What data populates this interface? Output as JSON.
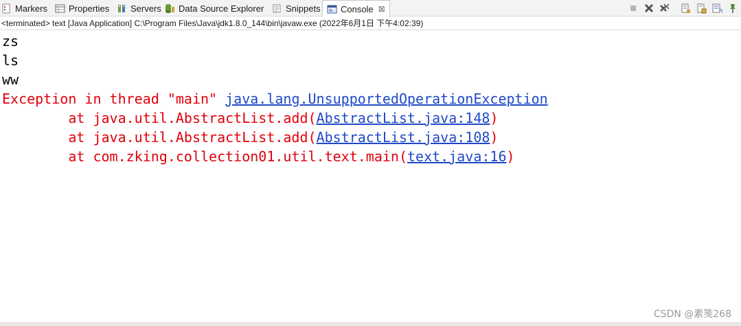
{
  "tabs": [
    {
      "label": "Markers",
      "icon": "markers-icon",
      "active": false
    },
    {
      "label": "Properties",
      "icon": "properties-icon",
      "active": false
    },
    {
      "label": "Servers",
      "icon": "servers-icon",
      "active": false
    },
    {
      "label": "Data Source Explorer",
      "icon": "data-source-icon",
      "active": false
    },
    {
      "label": "Snippets",
      "icon": "snippets-icon",
      "active": false
    },
    {
      "label": "Console",
      "icon": "console-icon",
      "active": true,
      "close": "⊠"
    }
  ],
  "toolbar_icons": [
    "terminate-icon",
    "remove-launch-icon",
    "remove-all-launches-icon",
    "clear-console-icon",
    "scroll-lock-icon",
    "word-wrap-icon",
    "pin-console-icon"
  ],
  "status": "<terminated> text [Java Application] C:\\Program Files\\Java\\jdk1.8.0_144\\bin\\javaw.exe (2022年6月1日 下午4:02:39)",
  "console": {
    "out_lines": [
      "zs",
      "ls",
      "ww"
    ],
    "exception_prefix": "Exception in thread \"main\" ",
    "exception_class": "java.lang.UnsupportedOperationException",
    "stack": [
      {
        "prefix": "        at java.util.AbstractList.add(",
        "link": "AbstractList.java:148",
        "suffix": ")"
      },
      {
        "prefix": "        at java.util.AbstractList.add(",
        "link": "AbstractList.java:108",
        "suffix": ")"
      },
      {
        "prefix": "        at com.zking.collection01.util.text.main(",
        "link": "text.java:16",
        "suffix": ")"
      }
    ]
  },
  "colors": {
    "stdout": "#000000",
    "stderr": "#e0000c",
    "link": "#1f49c9"
  },
  "watermark": "CSDN @素笺268"
}
